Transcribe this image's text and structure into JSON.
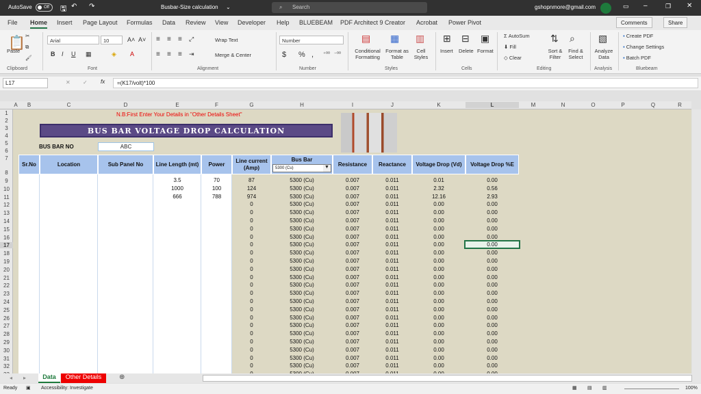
{
  "titlebar": {
    "autosave": "AutoSave",
    "toggle": "Off",
    "filename": "Busbar-Size calculation",
    "search": "Search",
    "user": "gshopnmore@gmail.com"
  },
  "tabs": [
    "File",
    "Home",
    "Insert",
    "Page Layout",
    "Formulas",
    "Data",
    "Review",
    "View",
    "Developer",
    "Help",
    "BLUEBEAM",
    "PDF Architect 9 Creator",
    "Acrobat",
    "Power Pivot"
  ],
  "comments": "Comments",
  "share": "Share",
  "ribbon": {
    "paste": "Paste",
    "font": "Arial",
    "size": "10",
    "wrap": "Wrap Text",
    "merge": "Merge & Center",
    "number_format": "Number",
    "cond": "Conditional Formatting",
    "fmt_table": "Format as Table",
    "cell_styles": "Cell Styles",
    "insert": "Insert",
    "delete": "Delete",
    "format": "Format",
    "autosum": "AutoSum",
    "fill": "Fill",
    "clear": "Clear",
    "sort": "Sort & Filter",
    "find": "Find & Select",
    "analyze": "Analyze Data",
    "create_pdf": "Create PDF",
    "change_settings": "Change Settings",
    "batch_pdf": "Batch PDF",
    "groups": [
      "Clipboard",
      "Font",
      "Alignment",
      "Number",
      "Styles",
      "Cells",
      "Editing",
      "Analysis",
      "Bluebeam"
    ]
  },
  "formula_bar": {
    "name": "L17",
    "formula": "=(K17/volt)*100",
    "fx": "fx"
  },
  "columns": [
    "A",
    "B",
    "C",
    "D",
    "E",
    "F",
    "G",
    "H",
    "I",
    "J",
    "K",
    "L",
    "M",
    "N",
    "O",
    "P",
    "Q",
    "R"
  ],
  "sheet": {
    "note": "N.B:First Enter Your  Details in \"Other Details Sheet\"",
    "title": "BUS BAR  VOLTAGE DROP  CALCULATION",
    "busbar_label": "BUS BAR NO",
    "busbar_value": "ABC",
    "headers": [
      "Sr.No",
      "Location",
      "Sub Panel No",
      "Line Length (mt)",
      "Power",
      "Line current (Amp)",
      "Bus Bar",
      "Resistance",
      "Reactance",
      "Voltage Drop (Vd)",
      "Voltage Drop %E"
    ],
    "busbar_select": "5300 (Cu)",
    "rows": [
      {
        "len": "3.5",
        "pow": "70",
        "cur": "87",
        "vd": "0.01",
        "pct": "0.00"
      },
      {
        "len": "1000",
        "pow": "100",
        "cur": "124",
        "vd": "2.32",
        "pct": "0.56"
      },
      {
        "len": "666",
        "pow": "788",
        "cur": "974",
        "vd": "12.16",
        "pct": "2.93"
      }
    ],
    "default": {
      "cur": "0",
      "bus": "5300 (Cu)",
      "res": "0.007",
      "rea": "0.011",
      "vd": "0.00",
      "pct": "0.00"
    }
  },
  "sheet_tabs": [
    "Data",
    "Other Details"
  ],
  "status": {
    "ready": "Ready",
    "access": "Accessibility: Investigate",
    "zoom": "100%"
  }
}
